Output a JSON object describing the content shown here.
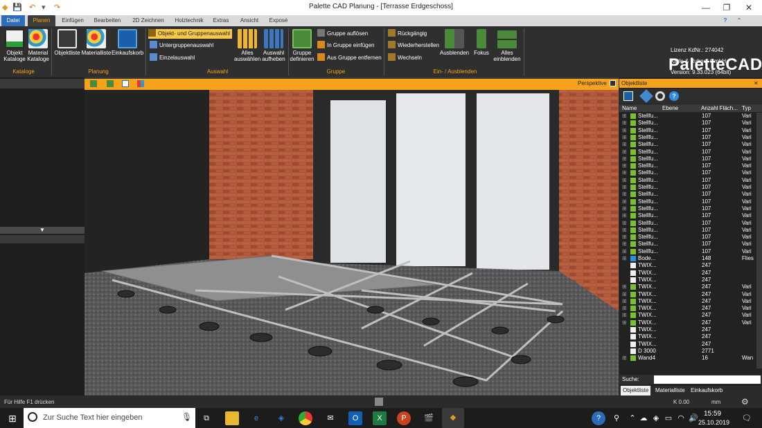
{
  "window": {
    "title": "Palette CAD Planung - [Terrasse Erdgeschoss]",
    "minimize": "—",
    "maximize": "❐",
    "close": "✕"
  },
  "tabs": [
    "Datei",
    "Planen",
    "Einfügen",
    "Bearbeiten",
    "2D Zeichnen",
    "Holztechnik",
    "Extras",
    "Ansicht",
    "Exposé"
  ],
  "ribbon": {
    "kataloge": {
      "label": "Kataloge",
      "items": [
        "Objekt\nKataloge",
        "Material\nKataloge"
      ]
    },
    "planung": {
      "label": "Planung",
      "items": [
        "Objektliste",
        "Materialliste",
        "Einkaufskorb"
      ]
    },
    "auswahl": {
      "label": "Auswahl",
      "small": [
        "Objekt- und Gruppenauswahl",
        "Untergruppenauswahl",
        "Einzelauswahl"
      ],
      "big": [
        "Alles\nauswählen",
        "Auswahl\naufheben"
      ]
    },
    "gruppe": {
      "label": "Gruppe",
      "big": "Gruppe\ndefinieren",
      "small": [
        "Gruppe auflösen",
        "In Gruppe einfügen",
        "Aus Gruppe entfernen"
      ]
    },
    "einaus": {
      "label": "Ein- / Ausblenden",
      "small": [
        "Rückgängig",
        "Wiederherstellen",
        "Wechseln"
      ],
      "big": [
        "Ausblenden",
        "Fokus",
        "Alles\neinblenden"
      ]
    }
  },
  "brand": {
    "name": "PaletteCAD",
    "lines": [
      "Lizenz KdNr.: 274042",
      "Karle & Rubner GmbH",
      "Version: 9.33.023 (64bit)"
    ]
  },
  "viewport": {
    "mode": "Perspektive"
  },
  "objectlist": {
    "title": "Objektliste",
    "columns": [
      "Name",
      "Ebene",
      "Anzahl Fläch...",
      "Typ"
    ],
    "rows": [
      {
        "name": "Stellfu...",
        "count": "107",
        "type": "Vari",
        "icon": "green"
      },
      {
        "name": "Stellfu...",
        "count": "107",
        "type": "Vari",
        "icon": "green"
      },
      {
        "name": "Stellfu...",
        "count": "107",
        "type": "Vari",
        "icon": "green"
      },
      {
        "name": "Stellfu...",
        "count": "107",
        "type": "Vari",
        "icon": "green"
      },
      {
        "name": "Stellfu...",
        "count": "107",
        "type": "Vari",
        "icon": "green"
      },
      {
        "name": "Stellfu...",
        "count": "107",
        "type": "Vari",
        "icon": "green"
      },
      {
        "name": "Stellfu...",
        "count": "107",
        "type": "Vari",
        "icon": "green"
      },
      {
        "name": "Stellfu...",
        "count": "107",
        "type": "Vari",
        "icon": "green"
      },
      {
        "name": "Stellfu...",
        "count": "107",
        "type": "Vari",
        "icon": "green"
      },
      {
        "name": "Stellfu...",
        "count": "107",
        "type": "Vari",
        "icon": "green"
      },
      {
        "name": "Stellfu...",
        "count": "107",
        "type": "Vari",
        "icon": "green"
      },
      {
        "name": "Stellfu...",
        "count": "107",
        "type": "Vari",
        "icon": "green"
      },
      {
        "name": "Stellfu...",
        "count": "107",
        "type": "Vari",
        "icon": "green"
      },
      {
        "name": "Stellfu...",
        "count": "107",
        "type": "Vari",
        "icon": "green"
      },
      {
        "name": "Stellfu...",
        "count": "107",
        "type": "Vari",
        "icon": "green"
      },
      {
        "name": "Stellfu...",
        "count": "107",
        "type": "Vari",
        "icon": "green"
      },
      {
        "name": "Stellfu...",
        "count": "107",
        "type": "Vari",
        "icon": "green"
      },
      {
        "name": "Stellfu...",
        "count": "107",
        "type": "Vari",
        "icon": "green"
      },
      {
        "name": "Stellfu...",
        "count": "107",
        "type": "Vari",
        "icon": "green"
      },
      {
        "name": "Stellfu...",
        "count": "107",
        "type": "Vari",
        "icon": "green"
      },
      {
        "name": "Bode...",
        "count": "148",
        "type": "Flies",
        "icon": "grid"
      },
      {
        "name": "TWIX...",
        "count": "247",
        "type": "",
        "icon": "folder"
      },
      {
        "name": "TWIX...",
        "count": "247",
        "type": "",
        "icon": "folder"
      },
      {
        "name": "TWIX...",
        "count": "247",
        "type": "",
        "icon": "folder"
      },
      {
        "name": "TWIX...",
        "count": "247",
        "type": "Vari",
        "icon": "green"
      },
      {
        "name": "TWIX...",
        "count": "247",
        "type": "Vari",
        "icon": "green"
      },
      {
        "name": "TWIX...",
        "count": "247",
        "type": "Vari",
        "icon": "green"
      },
      {
        "name": "TWIX...",
        "count": "247",
        "type": "Vari",
        "icon": "green"
      },
      {
        "name": "TWIX...",
        "count": "247",
        "type": "Vari",
        "icon": "green"
      },
      {
        "name": "TWIX...",
        "count": "247",
        "type": "Vari",
        "icon": "green"
      },
      {
        "name": "TWIX...",
        "count": "247",
        "type": "",
        "icon": "folder"
      },
      {
        "name": "TWIX...",
        "count": "247",
        "type": "",
        "icon": "folder"
      },
      {
        "name": "TWIX...",
        "count": "247",
        "type": "",
        "icon": "folder"
      },
      {
        "name": "D 3000",
        "count": "2771",
        "type": "",
        "icon": "folder"
      },
      {
        "name": "Wand4",
        "count": "16",
        "type": "Wan",
        "icon": "green"
      }
    ],
    "search_label": "Suche:",
    "bottom_tabs": [
      "Objektliste",
      "Materialliste",
      "Einkaufskorb"
    ]
  },
  "status": {
    "help": "Für Hilfe F1 drücken",
    "k": "K 0.00",
    "unit": "mm"
  },
  "taskbar": {
    "search_placeholder": "Zur Suche Text hier eingeben",
    "time": "15:59",
    "date": "25.10.2019"
  },
  "colors": {
    "accent": "#f7a21b",
    "ribbon": "#2f2f2f",
    "datei": "#2e6bb8"
  }
}
